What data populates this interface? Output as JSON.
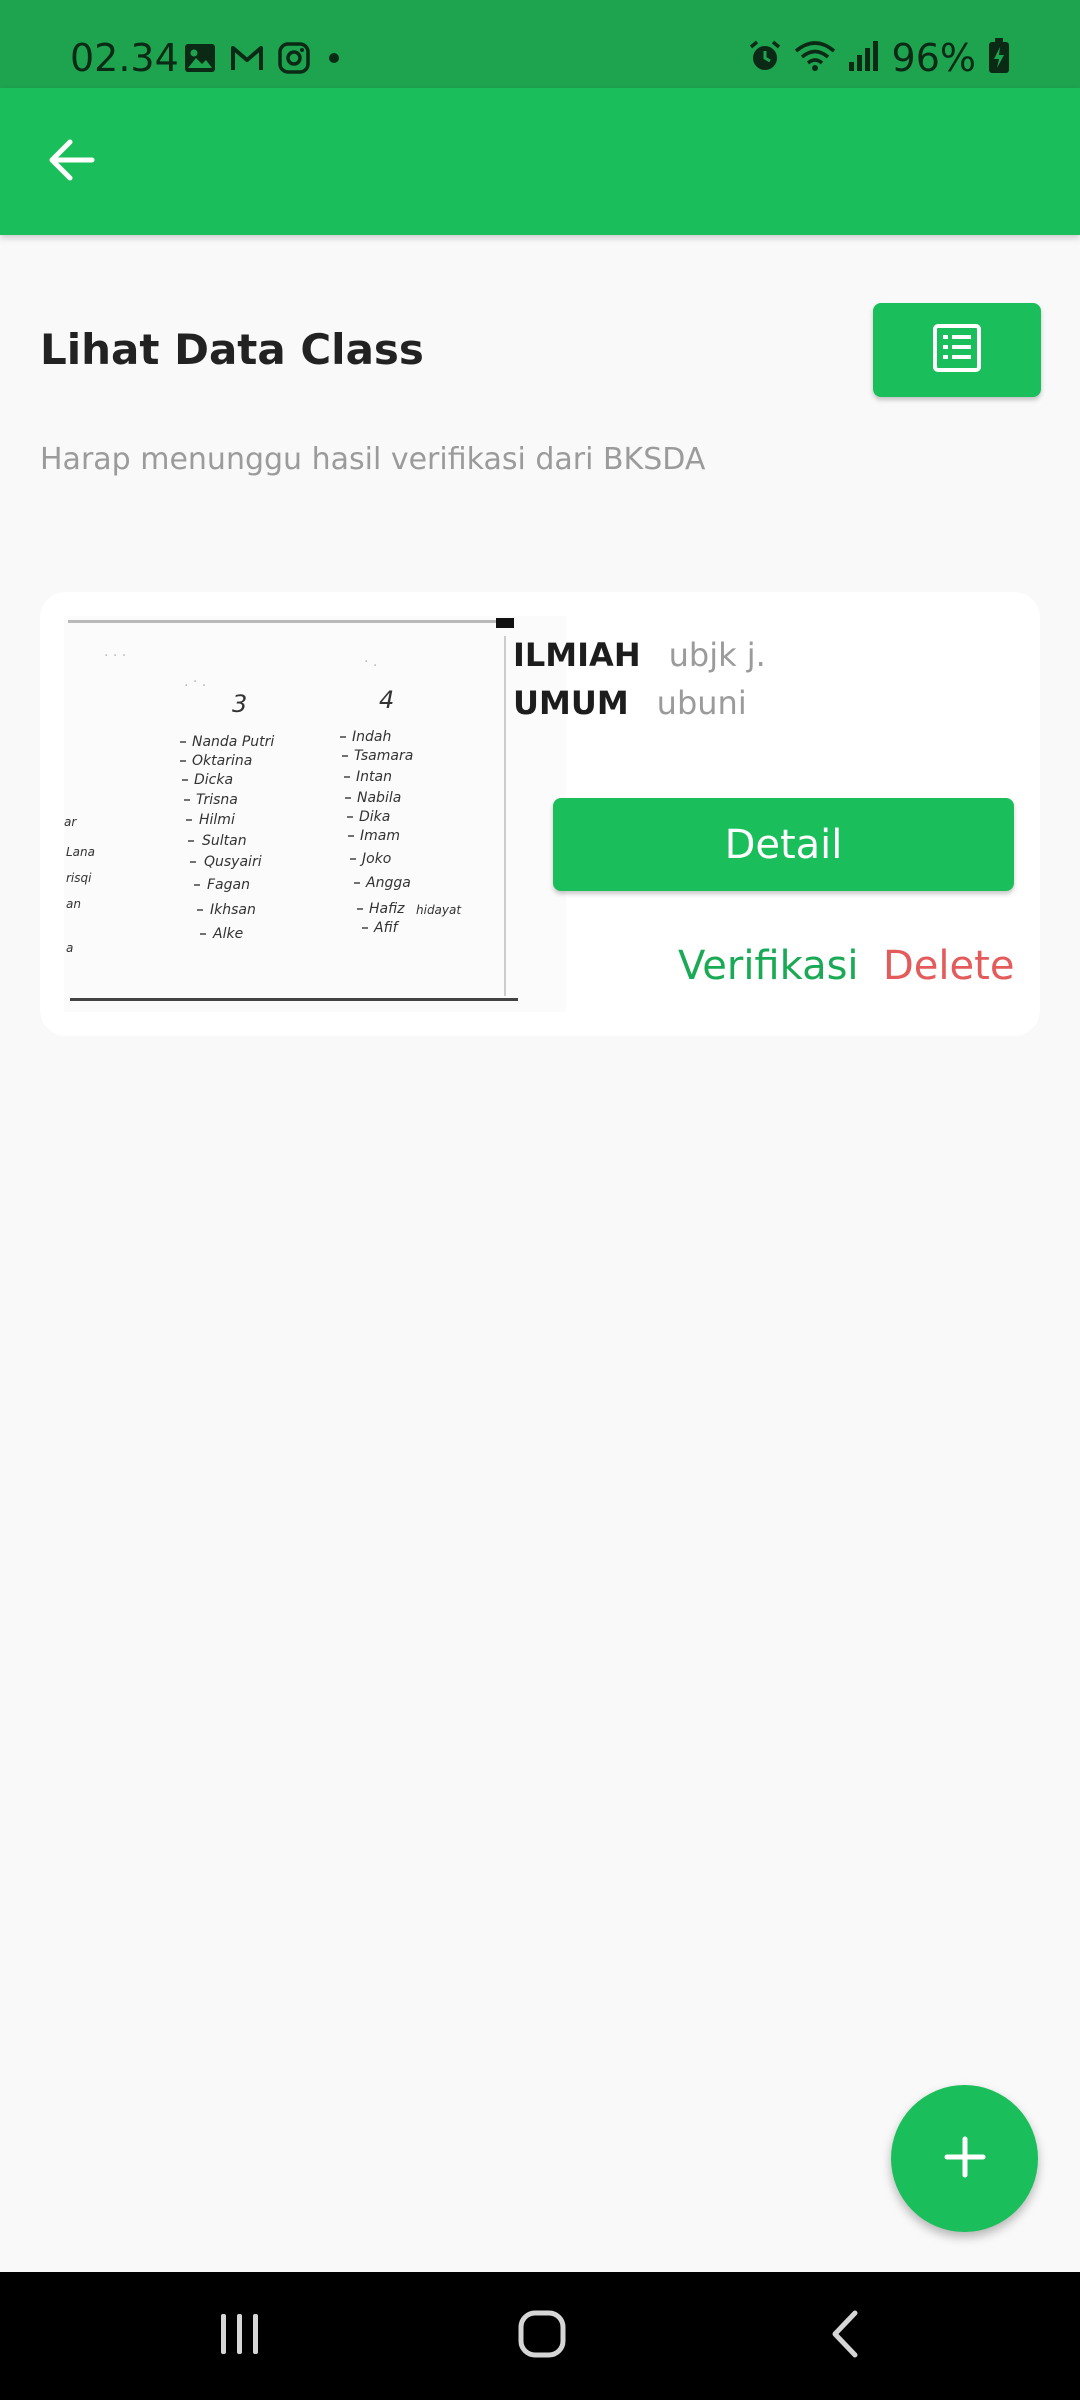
{
  "status_bar": {
    "time": "02.34",
    "battery": "96%",
    "left_icons": [
      "gallery-icon",
      "gmail-icon",
      "instagram-icon",
      "dot-icon"
    ],
    "right_icons": [
      "alarm-icon",
      "wifi-icon",
      "signal-icon",
      "battery-charging-icon"
    ]
  },
  "app_bar": {
    "back_icon": "arrow-left-icon",
    "color": "#1abf5b"
  },
  "page": {
    "title": "Lihat Data Class",
    "subtitle": "Harap menunggu hasil verifikasi dari BKSDA",
    "list_icon": "list-icon"
  },
  "card": {
    "fields": [
      {
        "label": "ILMIAH",
        "value": "ubjk j."
      },
      {
        "label": "UMUM",
        "value": "ubuni"
      }
    ],
    "detail_label": "Detail",
    "verify_label": "Verifikasi",
    "delete_label": "Delete",
    "image": {
      "column_headers": [
        "3",
        "4"
      ],
      "left_names": [
        "Nanda Putri",
        "Oktarina",
        "Dicka",
        "Trisna",
        "Hilmi",
        "Sultan",
        "Qusyairi",
        "Fagan",
        "Ikhsan",
        "Alke"
      ],
      "right_names": [
        "Indah",
        "Tsamara",
        "Intan",
        "Nabila",
        "Dika",
        "Imam",
        "Joko",
        "Angga",
        "Hafiz",
        "Afif"
      ],
      "right_extra": "hidayat",
      "edge_words": [
        "ar",
        "Lana",
        "risqi",
        "an",
        "a"
      ]
    }
  },
  "fab": {
    "icon": "plus-icon"
  },
  "nav_bar": {
    "icons": [
      "recent-apps-icon",
      "home-icon",
      "back-icon"
    ]
  },
  "colors": {
    "primary": "#1abf5b",
    "status_bar": "#1ea34f",
    "verify": "#1aaa55",
    "delete": "#e35b5b",
    "background": "#f9f9f9"
  }
}
